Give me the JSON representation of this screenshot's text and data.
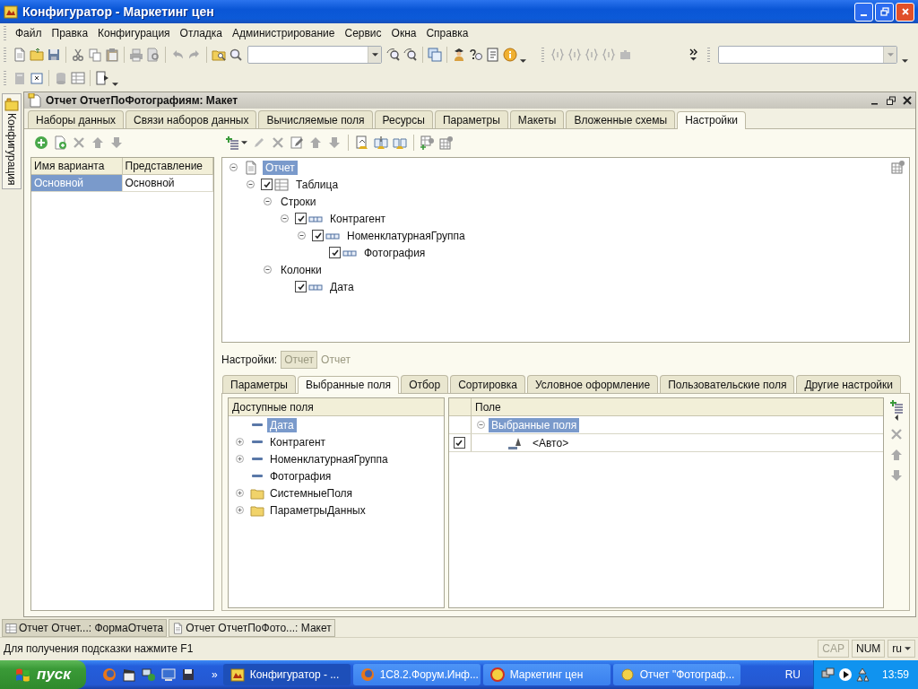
{
  "window": {
    "title": "Конфигуратор - Маркетинг цен"
  },
  "menu": [
    "Файл",
    "Правка",
    "Конфигурация",
    "Отладка",
    "Администрирование",
    "Сервис",
    "Окна",
    "Справка"
  ],
  "side_tab": {
    "label": "Конфигурация"
  },
  "document": {
    "title": "Отчет ОтчетПоФотографиям: Макет",
    "tabs": [
      {
        "label": "Наборы данных",
        "selected": false
      },
      {
        "label": "Связи наборов данных",
        "selected": false
      },
      {
        "label": "Вычисляемые поля",
        "selected": false
      },
      {
        "label": "Ресурсы",
        "selected": false
      },
      {
        "label": "Параметры",
        "selected": false
      },
      {
        "label": "Макеты",
        "selected": false
      },
      {
        "label": "Вложенные схемы",
        "selected": false
      },
      {
        "label": "Настройки",
        "selected": true
      }
    ]
  },
  "variants": {
    "columns": [
      "Имя варианта",
      "Представление"
    ],
    "rows": [
      {
        "cells": [
          "Основной",
          "Основной"
        ],
        "selected": true
      }
    ]
  },
  "structure_tree": [
    {
      "label": "Отчет",
      "kind": "report",
      "expanded": true,
      "selected": true,
      "children": [
        {
          "label": "Таблица",
          "kind": "table",
          "expanded": true,
          "checked": true,
          "selected": false,
          "children": [
            {
              "label": "Строки",
              "expanded": true,
              "selected": false,
              "children": [
                {
                  "label": "Контрагент",
                  "kind": "field",
                  "expanded": true,
                  "checked": true,
                  "selected": false,
                  "children": [
                    {
                      "label": "НоменклатурнаяГруппа",
                      "kind": "field",
                      "expanded": true,
                      "checked": true,
                      "selected": false,
                      "children": [
                        {
                          "label": "Фотография",
                          "kind": "field",
                          "checked": true,
                          "selected": false
                        }
                      ]
                    }
                  ]
                }
              ]
            },
            {
              "label": "Колонки",
              "expanded": true,
              "selected": false,
              "children": [
                {
                  "label": "Дата",
                  "kind": "field",
                  "checked": true,
                  "selected": false
                }
              ]
            }
          ]
        }
      ]
    }
  ],
  "settings_selector": {
    "label": "Настройки:",
    "button": "Отчет",
    "value": "Отчет"
  },
  "settings_tabs": [
    {
      "label": "Параметры",
      "selected": false
    },
    {
      "label": "Выбранные поля",
      "selected": true
    },
    {
      "label": "Отбор",
      "selected": false
    },
    {
      "label": "Сортировка",
      "selected": false
    },
    {
      "label": "Условное оформление",
      "selected": false
    },
    {
      "label": "Пользовательские поля",
      "selected": false
    },
    {
      "label": "Другие настройки",
      "selected": false
    }
  ],
  "available_fields": {
    "title": "Доступные поля",
    "items": [
      {
        "label": "Дата",
        "kind": "field",
        "selected": true
      },
      {
        "label": "Контрагент",
        "kind": "field",
        "expanded": false,
        "selected": false
      },
      {
        "label": "НоменклатурнаяГруппа",
        "kind": "field",
        "expanded": false,
        "selected": false
      },
      {
        "label": "Фотография",
        "kind": "field",
        "selected": false
      },
      {
        "label": "СистемныеПоля",
        "kind": "folder",
        "expanded": false,
        "selected": false
      },
      {
        "label": "ПараметрыДанных",
        "kind": "folder",
        "expanded": false,
        "selected": false
      }
    ]
  },
  "selected_fields": {
    "column": "Поле",
    "rows": [
      {
        "label": "Выбранные поля",
        "kind": "group",
        "expanded": true,
        "selected": true
      },
      {
        "label": "<Авто>",
        "kind": "auto",
        "checked": true,
        "selected": false
      }
    ]
  },
  "window_tabs": [
    {
      "label": "Отчет Отчет...: ФормаОтчета",
      "selected": false
    },
    {
      "label": "Отчет ОтчетПоФото...: Макет",
      "selected": true
    }
  ],
  "status_bar": {
    "hint": "Для получения подсказки нажмите F1",
    "indicators": [
      {
        "label": "CAP",
        "on": false
      },
      {
        "label": "NUM",
        "on": true
      }
    ],
    "language": "ru"
  },
  "taskbar": {
    "start": "пуск",
    "more": "»",
    "buttons": [
      {
        "label": "Конфигуратор - ...",
        "kind": "configurator",
        "selected": true
      },
      {
        "label": "1С8.2.Форум.Инф...",
        "kind": "browser",
        "selected": false
      },
      {
        "label": "Маркетинг цен",
        "kind": "enterprise",
        "selected": false
      },
      {
        "label": "Отчет \"Фотограф...",
        "kind": "report",
        "selected": false
      }
    ],
    "language": "RU",
    "clock": "13:59"
  }
}
